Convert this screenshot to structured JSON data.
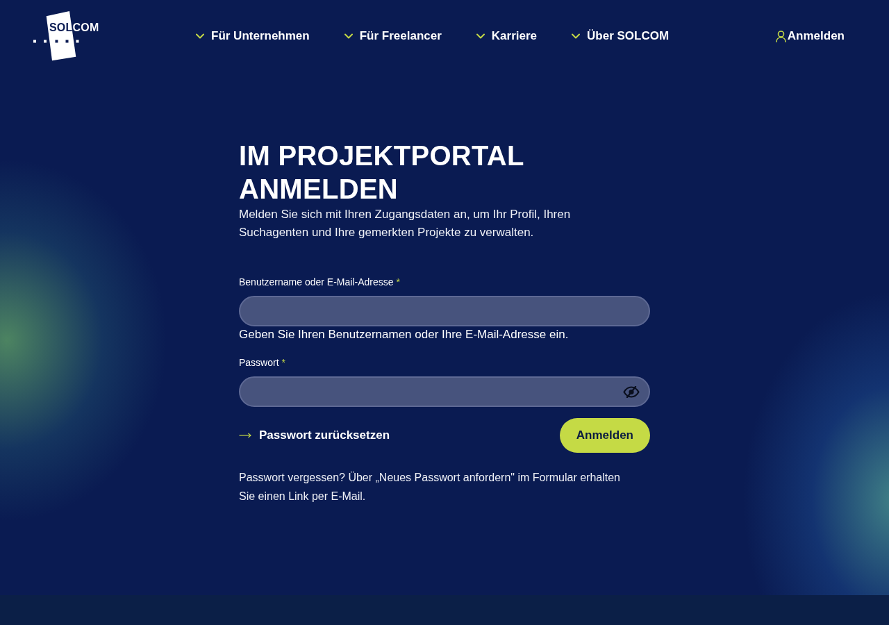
{
  "header": {
    "logo": {
      "text": "SOLCOM"
    },
    "nav": [
      {
        "label": "Für Unternehmen"
      },
      {
        "label": "Für Freelancer"
      },
      {
        "label": "Karriere"
      },
      {
        "label": "Über SOLCOM"
      }
    ],
    "login_link": {
      "label": "Anmelden"
    }
  },
  "login": {
    "title": "IM PROJEKTPORTAL ANMELDEN",
    "intro": "Melden Sie sich mit Ihren Zugangsdaten an, um Ihr Profil, Ihren Suchagenten und Ihre gemerkten Projekte zu verwalten.",
    "fields": [
      {
        "kind": "text",
        "label": "Benutzername oder E-Mail-Adresse",
        "required_mark": "*",
        "hint": "Geben Sie Ihren Benutzernamen oder Ihre E-Mail-Adresse ein."
      },
      {
        "kind": "password",
        "label": "Passwort",
        "required_mark": "*"
      }
    ],
    "reset_link": {
      "label": "Passwort zurücksetzen"
    },
    "submit": {
      "label": "Anmelden"
    },
    "note": "Passwort vergessen? Über „Neues Passwort anfordern\" im Formular erhalten Sie einen Link per E-Mail."
  }
}
